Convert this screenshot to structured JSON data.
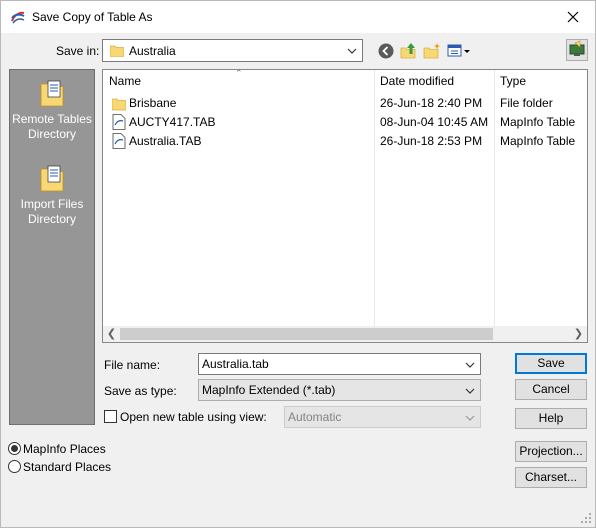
{
  "window": {
    "title": "Save Copy of Table As"
  },
  "toolbar": {
    "save_in_label": "Save in:",
    "save_in_value": "Australia",
    "icons": [
      "back-icon",
      "up-folder-icon",
      "new-folder-icon",
      "view-menu-icon",
      "desktop-icon"
    ]
  },
  "places": [
    {
      "label": "Remote Tables Directory"
    },
    {
      "label": "Import Files Directory"
    }
  ],
  "file_list": {
    "columns": [
      "Name",
      "Date modified",
      "Type"
    ],
    "rows": [
      {
        "name": "Brisbane",
        "date": "26-Jun-18 2:40 PM",
        "type": "File folder",
        "icon": "folder-icon"
      },
      {
        "name": "AUCTY417.TAB",
        "date": "08-Jun-04 10:45 AM",
        "type": "MapInfo Table",
        "icon": "mapinfo-table-icon"
      },
      {
        "name": "Australia.TAB",
        "date": "26-Jun-18 2:53 PM",
        "type": "MapInfo Table",
        "icon": "mapinfo-table-icon"
      }
    ]
  },
  "form": {
    "file_name_label": "File name:",
    "file_name_value": "Australia.tab",
    "save_as_type_label": "Save as type:",
    "save_as_type_value": "MapInfo Extended (*.tab)",
    "open_view_label": "Open new table using view:",
    "open_view_checked": false,
    "open_view_value": "Automatic"
  },
  "buttons": {
    "save": "Save",
    "cancel": "Cancel",
    "help": "Help",
    "projection": "Projection...",
    "charset": "Charset..."
  },
  "place_options": {
    "mapinfo_places": "MapInfo Places",
    "standard_places": "Standard Places",
    "selected": "MapInfo Places"
  },
  "colors": {
    "accent": "#0078d7",
    "places_bar": "#969696",
    "folder": "#f8d775"
  }
}
